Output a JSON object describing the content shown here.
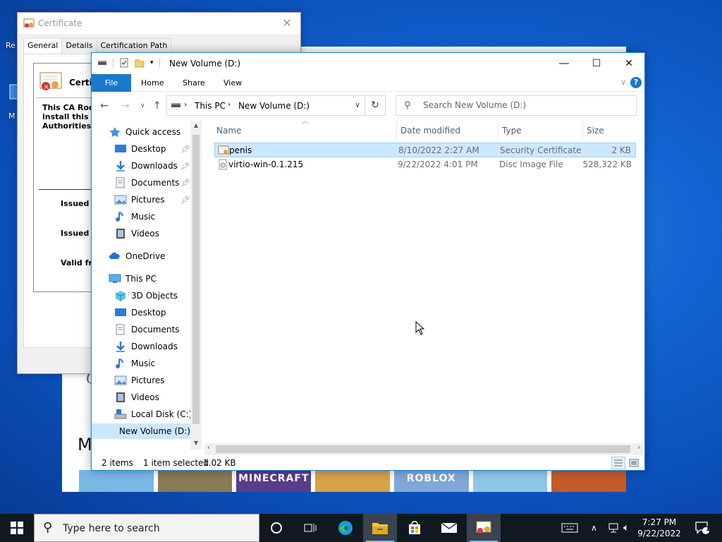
{
  "desktop": {
    "icon_labels": [
      "Re",
      "M"
    ]
  },
  "background_window": {
    "heading_letter": "M",
    "cursive_letter": "C",
    "tiles": [
      {
        "label": "",
        "color": "#7ab8e8"
      },
      {
        "label": "",
        "color": "#8a7a55"
      },
      {
        "label": "MINECRAFT",
        "color": "#5a3d8a"
      },
      {
        "label": "",
        "color": "#d7a24a"
      },
      {
        "label": "ROBLOX",
        "color": "#7fa8d8"
      },
      {
        "label": "",
        "color": "#8fc7e8"
      },
      {
        "label": "",
        "color": "#c55a2a"
      }
    ]
  },
  "certificate": {
    "title": "Certificate",
    "tabs": [
      "General",
      "Details",
      "Certification Path"
    ],
    "header": "Certific",
    "message_lines": [
      "This CA Root",
      "install this ce",
      "Authorities s"
    ],
    "issued_to": "Issued t",
    "issued_by": "Issued b",
    "valid_from": "Valid fro"
  },
  "explorer": {
    "title": "New Volume (D:)",
    "ribbon_tabs": {
      "file": "File",
      "home": "Home",
      "share": "Share",
      "view": "View"
    },
    "help": "?",
    "address": {
      "root": "This PC",
      "current": "New Volume (D:)"
    },
    "search_placeholder": "Search New Volume (D:)",
    "nav": {
      "quick_access": "Quick access",
      "qa_items": [
        "Desktop",
        "Downloads",
        "Documents",
        "Pictures",
        "Music",
        "Videos"
      ],
      "onedrive": "OneDrive",
      "this_pc": "This PC",
      "pc_items": [
        "3D Objects",
        "Desktop",
        "Documents",
        "Downloads",
        "Music",
        "Pictures",
        "Videos",
        "Local Disk (C:)",
        "New Volume (D:)"
      ]
    },
    "columns": {
      "name": "Name",
      "date": "Date modified",
      "type": "Type",
      "size": "Size"
    },
    "files": [
      {
        "name": "penis",
        "date": "8/10/2022 2:27 AM",
        "type": "Security Certificate",
        "size": "2 KB",
        "selected": true
      },
      {
        "name": "virtio-win-0.1.215",
        "date": "9/22/2022 4:01 PM",
        "type": "Disc Image File",
        "size": "528,322 KB",
        "selected": false
      }
    ],
    "status": {
      "count": "2 items",
      "selected": "1 item selected",
      "size": "1.02 KB"
    }
  },
  "taskbar": {
    "search_placeholder": "Type here to search",
    "time": "7:27 PM",
    "date": "9/22/2022",
    "notification_count": "1"
  }
}
